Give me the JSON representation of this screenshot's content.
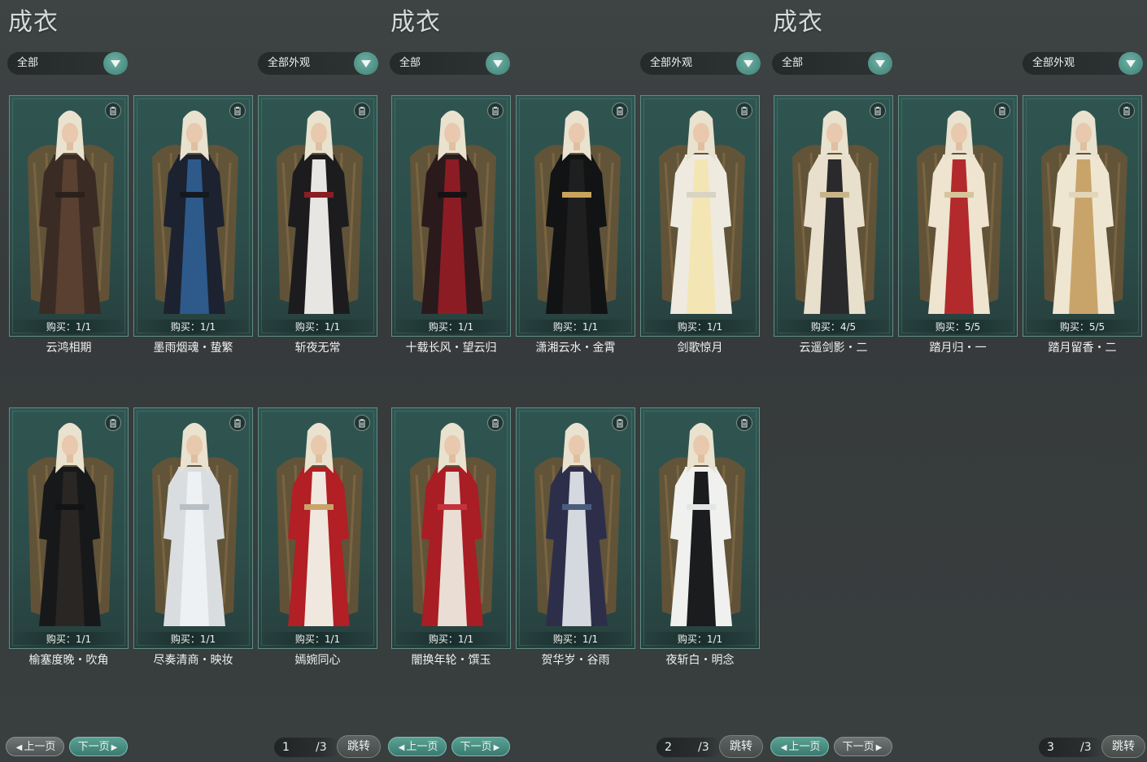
{
  "panels": [
    {
      "title": "成衣",
      "filter_all": "全部",
      "filter_look": "全部外观",
      "items": [
        {
          "buy": "购买：1/1",
          "name": "云鸿相期",
          "palette": [
            "#3a2c24",
            "#5a4030",
            "#2a211c"
          ]
        },
        {
          "buy": "购买：1/1",
          "name": "墨雨烟魂・蛰繁",
          "palette": [
            "#1c2230",
            "#2d5a8a",
            "#15181f"
          ]
        },
        {
          "buy": "购买：1/1",
          "name": "斩夜无常",
          "palette": [
            "#1c1c1f",
            "#e8e6e2",
            "#8a1e22"
          ]
        },
        {
          "buy": "购买：1/1",
          "name": "榆塞度晚・吹角",
          "palette": [
            "#17181a",
            "#2a2624",
            "#121314"
          ]
        },
        {
          "buy": "购买：1/1",
          "name": "尽奏清商・映妆",
          "palette": [
            "#d9dde0",
            "#eef1f3",
            "#b8c0c6"
          ]
        },
        {
          "buy": "购买：1/1",
          "name": "嫣婉同心",
          "palette": [
            "#b21f24",
            "#f0e8df",
            "#c8a46a"
          ]
        }
      ],
      "prev": "上一页",
      "next": "下一页",
      "page": "1",
      "total": "/3",
      "jump": "跳转",
      "active_nav": "next"
    },
    {
      "title": "成衣",
      "filter_all": "全部",
      "filter_look": "全部外观",
      "items": [
        {
          "buy": "购买：1/1",
          "name": "十载长风・望云归",
          "palette": [
            "#2a1a1c",
            "#8c1c24",
            "#151213"
          ]
        },
        {
          "buy": "购买：1/1",
          "name": "潇湘云水・金霄",
          "palette": [
            "#121314",
            "#1f1f20",
            "#c9a45c"
          ]
        },
        {
          "buy": "购买：1/1",
          "name": "剑歌惊月",
          "palette": [
            "#eeeae0",
            "#f3e6b4",
            "#d9d3c4"
          ]
        },
        {
          "buy": "购买：1/1",
          "name": "闇换年轮・馔玉",
          "palette": [
            "#a81e24",
            "#e9ddd4",
            "#c4333a"
          ]
        },
        {
          "buy": "购买：1/1",
          "name": "贺华岁・谷雨",
          "palette": [
            "#2d2f4a",
            "#d6d8df",
            "#4a5d7d"
          ]
        },
        {
          "buy": "购买：1/1",
          "name": "夜斩白・明念",
          "palette": [
            "#f0f0ee",
            "#1a1c1e",
            "#e4e6e6"
          ]
        }
      ],
      "prev": "上一页",
      "next": "下一页",
      "page": "2",
      "total": "/3",
      "jump": "跳转",
      "active_nav": "both"
    },
    {
      "title": "成衣",
      "filter_all": "全部",
      "filter_look": "全部外观",
      "items": [
        {
          "buy": "购买：4/5",
          "name": "云遥剑影・二",
          "palette": [
            "#e8e0cc",
            "#2a2a2c",
            "#c9b48a"
          ]
        },
        {
          "buy": "购买：5/5",
          "name": "踏月归・一",
          "palette": [
            "#eee4cf",
            "#b32a2c",
            "#d8c49a"
          ]
        },
        {
          "buy": "购买：5/5",
          "name": "踏月留香・二",
          "palette": [
            "#efe6d2",
            "#c9a46a",
            "#e3d6b8"
          ]
        }
      ],
      "prev": "上一页",
      "next": "下一页",
      "page": "3",
      "total": "/3",
      "jump": "跳转",
      "active_nav": "prev"
    }
  ]
}
